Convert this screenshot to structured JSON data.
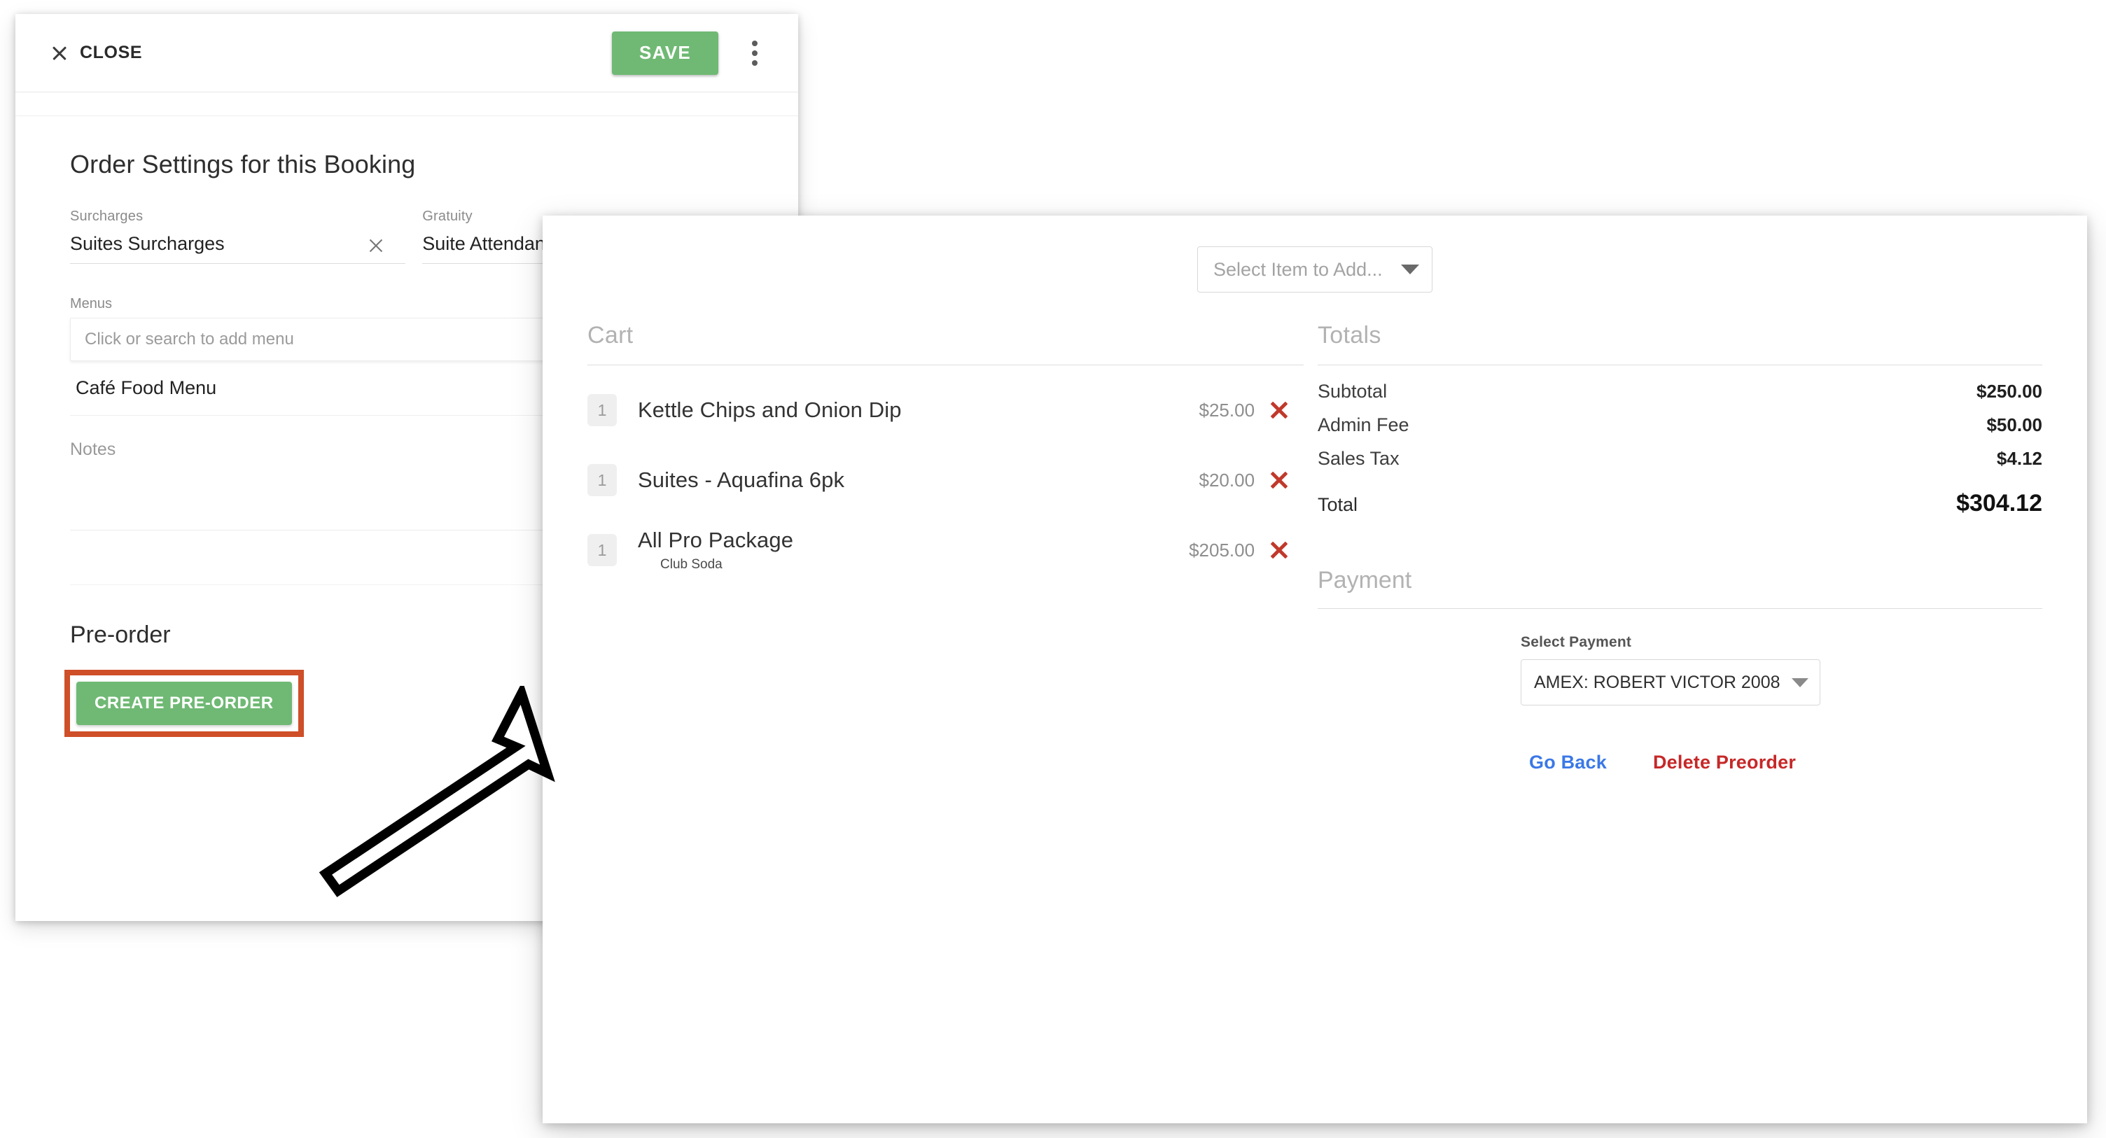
{
  "booking_panel": {
    "close_label": "CLOSE",
    "close_icon": "close-x-icon",
    "save_label": "SAVE",
    "overflow_icon": "kebab-menu-icon",
    "section_title": "Order Settings for this Booking",
    "fields": {
      "surcharges": {
        "label": "Surcharges",
        "value": "Suites Surcharges",
        "clear_icon": "clear-x-icon"
      },
      "gratuity": {
        "label": "Gratuity",
        "value": "Suite Attendant"
      }
    },
    "menus": {
      "label": "Menus",
      "placeholder": "Click or search to add menu",
      "items": [
        {
          "name": "Café Food Menu"
        }
      ]
    },
    "notes": {
      "label": "Notes",
      "value": ""
    },
    "preorder": {
      "title": "Pre-order",
      "create_label": "CREATE PRE-ORDER",
      "highlight_color": "#ce4f28"
    }
  },
  "preorder_modal": {
    "add_item": {
      "placeholder": "Select Item to Add...",
      "caret_icon": "chevron-down-icon"
    },
    "cart": {
      "heading": "Cart",
      "items": [
        {
          "qty": "1",
          "name": "Kettle Chips and Onion Dip",
          "sub": "",
          "price": "$25.00",
          "remove_icon": "remove-x-icon"
        },
        {
          "qty": "1",
          "name": "Suites - Aquafina 6pk",
          "sub": "",
          "price": "$20.00",
          "remove_icon": "remove-x-icon"
        },
        {
          "qty": "1",
          "name": "All Pro Package",
          "sub": "Club Soda",
          "price": "$205.00",
          "remove_icon": "remove-x-icon"
        }
      ]
    },
    "totals": {
      "heading": "Totals",
      "rows": [
        {
          "label": "Subtotal",
          "value": "$250.00"
        },
        {
          "label": "Admin Fee",
          "value": "$50.00"
        },
        {
          "label": "Sales Tax",
          "value": "$4.12"
        }
      ],
      "grand": {
        "label": "Total",
        "value": "$304.12"
      }
    },
    "payment": {
      "heading": "Payment",
      "select_label": "Select Payment",
      "selected": "AMEX: ROBERT VICTOR 2008",
      "caret_icon": "chevron-down-icon"
    },
    "actions": {
      "go_back": "Go Back",
      "delete_preorder": "Delete Preorder",
      "go_back_color": "#3b78e7",
      "delete_color": "#c62828"
    }
  },
  "annotation": {
    "arrow_icon": "pointer-arrow-icon",
    "arrow_color": "#000000"
  },
  "theme": {
    "primary_green": "#6fb974",
    "highlight_orange": "#ce4f28",
    "danger_red": "#c0392b",
    "link_blue": "#3b78e7"
  }
}
